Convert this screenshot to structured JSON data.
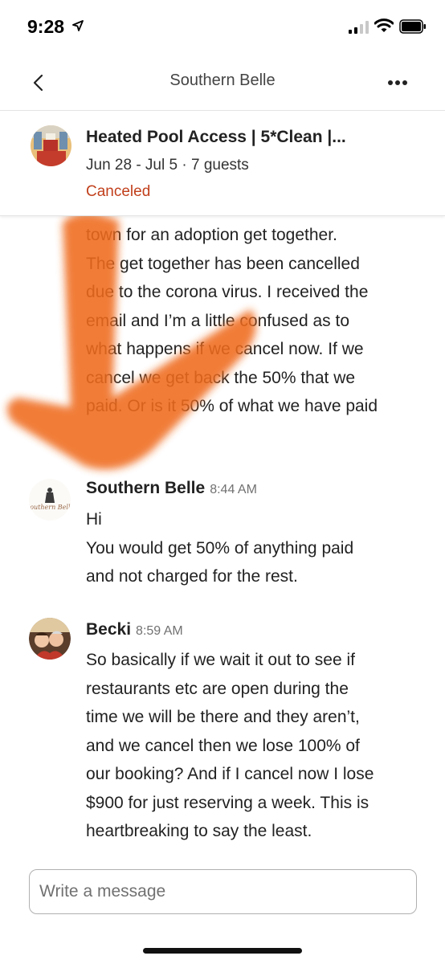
{
  "status_bar": {
    "time": "9:28"
  },
  "header": {
    "title": "Southern Belle",
    "back_icon": "chevron-left-icon",
    "more_icon": "more-horizontal-icon"
  },
  "listing": {
    "title": "Heated Pool Access | 5*Clean |...",
    "dates": "Jun 28 - Jul 5",
    "guests": "7 guests",
    "status": "Canceled",
    "status_color": "#c1401c"
  },
  "messages": {
    "previous": [
      "town for an adoption get together.",
      "The get together has been cancelled",
      "due to the corona virus. I received the",
      "email and I’m a little confused as to",
      "what happens if we cancel now. If we",
      "cancel we get back the 50% that we",
      "paid. Or is it 50% of what we have paid"
    ],
    "host": {
      "name": "Southern Belle",
      "time": "8:44 AM",
      "avatar_text": "Southern Belle",
      "lines": [
        "Hi",
        "You would get 50% of anything paid",
        "and not charged for the rest."
      ]
    },
    "guest": {
      "name": "Becki",
      "time": "8:59 AM",
      "lines": [
        "So basically if we wait it out to see if",
        "restaurants etc are open during the",
        "time we will be there and they aren’t,",
        "and we cancel then we lose 100% of",
        "our booking? And if I cancel now I lose",
        "$900 for just reserving a week. This is",
        "heartbreaking to say the least."
      ]
    }
  },
  "composer": {
    "placeholder": "Write a message"
  },
  "annotation": {
    "arrow_color": "#ef6a1c"
  }
}
